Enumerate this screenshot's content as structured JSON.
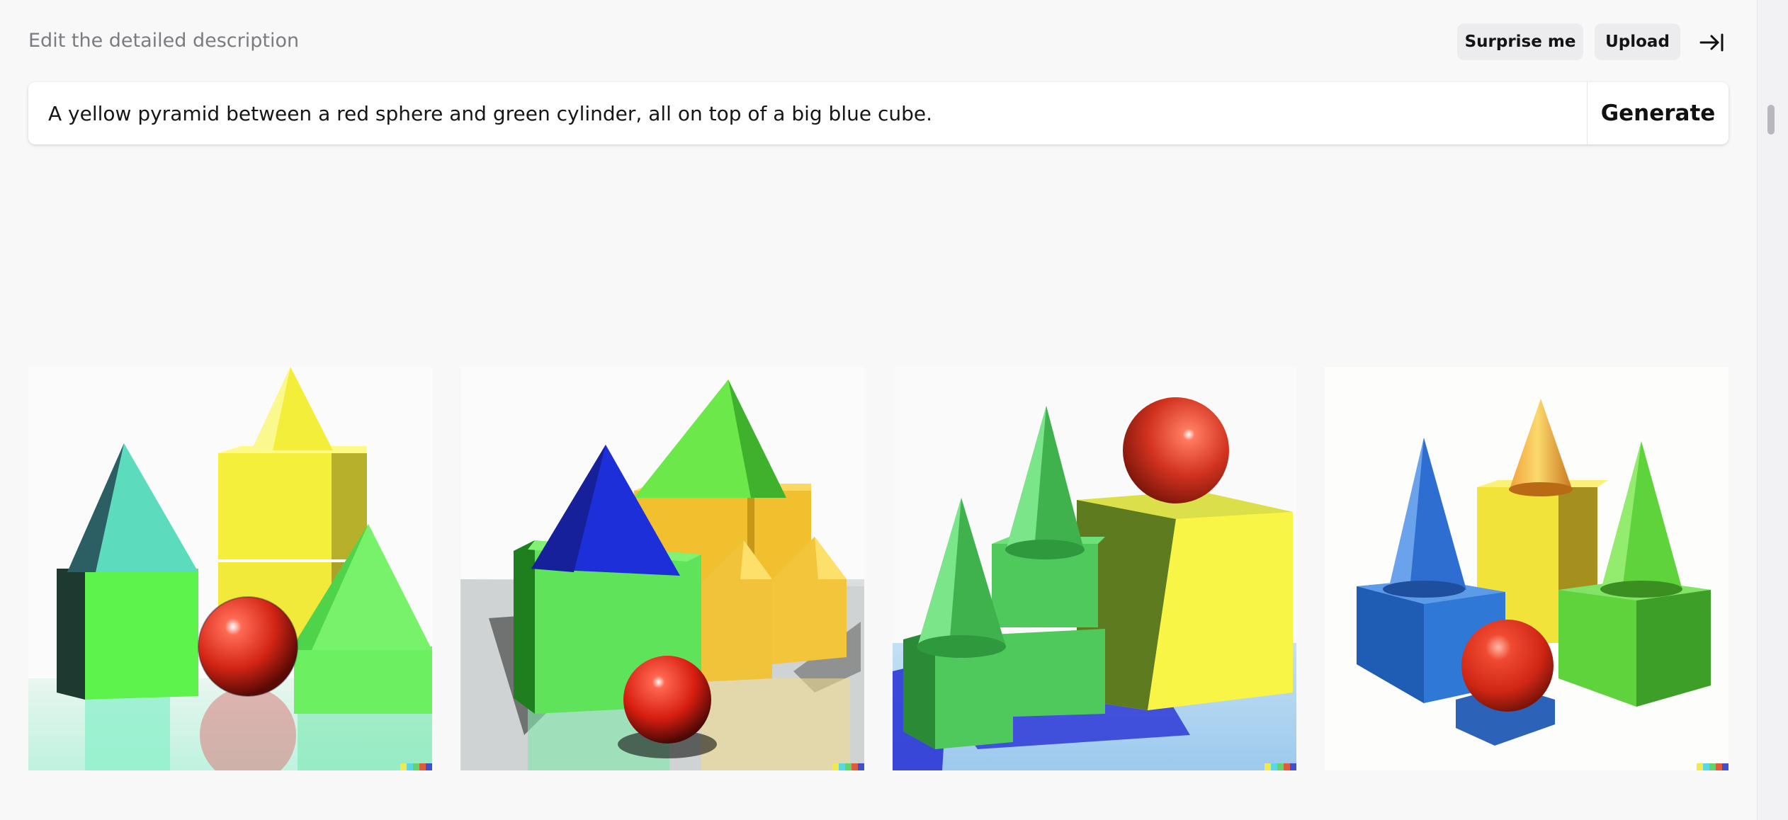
{
  "header": {
    "label": "Edit the detailed description",
    "surprise_label": "Surprise me",
    "upload_label": "Upload",
    "collapse_icon": "arrow-right-to-bar-icon"
  },
  "prompt": {
    "value": "A yellow pyramid between a red sphere and green cylinder, all on top of a big blue cube.",
    "generate_label": "Generate"
  },
  "results": [
    {
      "name": "generated-image-1",
      "description": "teal pyramid on green cube, yellow cone on yellow boxes, red sphere, green pyramid"
    },
    {
      "name": "generated-image-2",
      "description": "blue pyramid on green cube, green pyramid on yellow block, red sphere"
    },
    {
      "name": "generated-image-3",
      "description": "green cones on green cubes, red sphere on big yellow cube"
    },
    {
      "name": "generated-image-4",
      "description": "blue cone on blue cube, orange cone on yellow box, green cone on green cube, red sphere"
    }
  ],
  "colors": {
    "background": "#f8f8f9",
    "button_bg": "#ececee",
    "text_muted": "#7b7b80"
  }
}
